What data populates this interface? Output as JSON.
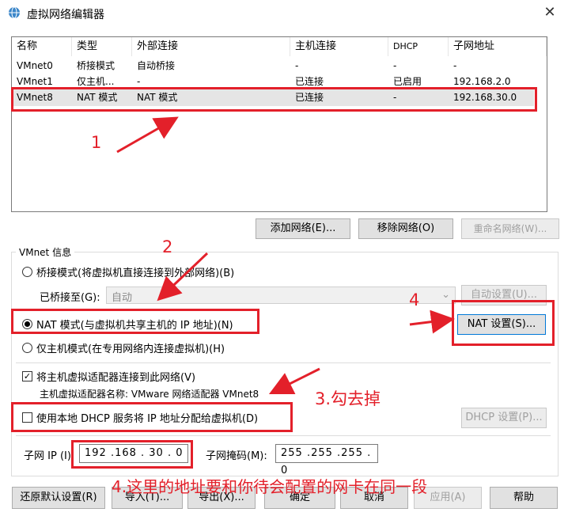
{
  "window": {
    "title": "虚拟网络编辑器",
    "icon": "globe-network-icon",
    "close_symbol": "✕"
  },
  "table": {
    "headers": [
      "名称",
      "类型",
      "外部连接",
      "主机连接",
      "DHCP",
      "子网地址"
    ],
    "rows": [
      [
        "VMnet0",
        "桥接模式",
        "自动桥接",
        "-",
        "-",
        "-"
      ],
      [
        "VMnet1",
        "仅主机...",
        "-",
        "已连接",
        "已启用",
        "192.168.2.0"
      ],
      [
        "VMnet8",
        "NAT 模式",
        "NAT 模式",
        "已连接",
        "-",
        "192.168.30.0"
      ]
    ],
    "selected_row": 2
  },
  "buttons": {
    "add_network": "添加网络(E)...",
    "remove_network": "移除网络(O)",
    "rename_network": "重命名网络(W)...",
    "auto_settings": "自动设置(U)...",
    "nat_settings": "NAT 设置(S)...",
    "dhcp_settings": "DHCP 设置(P)...",
    "restore_defaults": "还原默认设置(R)",
    "import": "导入(T)...",
    "export": "导出(X)...",
    "ok": "确定",
    "cancel": "取消",
    "apply": "应用(A)",
    "help": "帮助"
  },
  "vmnet_info": {
    "group_label": "VMnet 信息",
    "bridged_radio": "桥接模式(将虚拟机直接连接到外部网络)(B)",
    "bridged_to_label": "已桥接至(G):",
    "bridged_to_value": "自动",
    "nat_radio": "NAT 模式(与虚拟机共享主机的 IP 地址)(N)",
    "host_only_radio": "仅主机模式(在专用网络内连接虚拟机)(H)",
    "connect_adapter_check": "将主机虚拟适配器连接到此网络(V)",
    "connect_adapter_checked": true,
    "adapter_name_label": "主机虚拟适配器名称: VMware 网络适配器 VMnet8",
    "dhcp_check": "使用本地 DHCP 服务将 IP 地址分配给虚拟机(D)",
    "dhcp_checked": false,
    "selected_mode": "nat",
    "subnet_ip_label": "子网 IP (I):",
    "subnet_ip_value": "192 .168 . 30 . 0",
    "subnet_mask_label": "子网掩码(M):",
    "subnet_mask_value": "255 .255 .255 . 0"
  },
  "annotations": {
    "a1": "1",
    "a2": "2",
    "a3": "3.勾去掉",
    "a4": "4",
    "a4_note": "4.这里的地址要和你待会配置的网卡在同一段",
    "color": "#e3202a"
  }
}
